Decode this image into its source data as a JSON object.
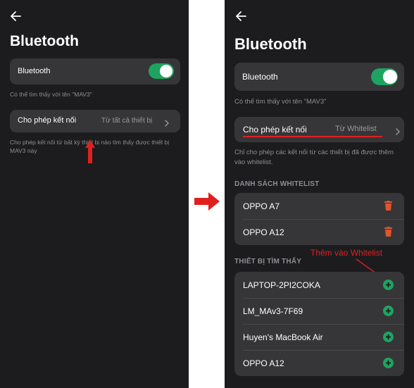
{
  "left": {
    "title": "Bluetooth",
    "bluetooth_label": "Bluetooth",
    "visible_text": "Có thể tìm thấy với tên \"MAV3\"",
    "allow_label": "Cho phép kết nối",
    "allow_value": "Từ tất cả thiết bị",
    "allow_hint": "Cho phép kết nối từ bất kỳ thiết bị nào tìm thấy được thiết bị MAV3 này"
  },
  "right": {
    "title": "Bluetooth",
    "bluetooth_label": "Bluetooth",
    "visible_text": "Có thể tìm thấy với tên \"MAV3\"",
    "allow_label": "Cho phép kết nối",
    "allow_value": "Từ Whitelist",
    "allow_hint": "Chỉ cho phép các kết nối từ các thiết bị đã được thêm vào whitelist.",
    "whitelist_header": "DANH SÁCH WHITELIST",
    "whitelist": [
      {
        "name": "OPPO A7"
      },
      {
        "name": "OPPO A12"
      }
    ],
    "found_header": "THIẾT BỊ TÌM THẤY",
    "found": [
      {
        "name": "LAPTOP-2PI2COKA"
      },
      {
        "name": "LM_MAv3-7F69"
      },
      {
        "name": "Huyen's MacBook Air"
      },
      {
        "name": "OPPO A12"
      }
    ],
    "annotation": "Thêm vào Whitelist"
  },
  "colors": {
    "background": "#1c1c1e",
    "card": "#363638",
    "toggle_on": "#1fa360",
    "delete": "#e0552b",
    "add": "#1fa360",
    "annotation_red": "#e02020"
  },
  "toggle_on": true
}
